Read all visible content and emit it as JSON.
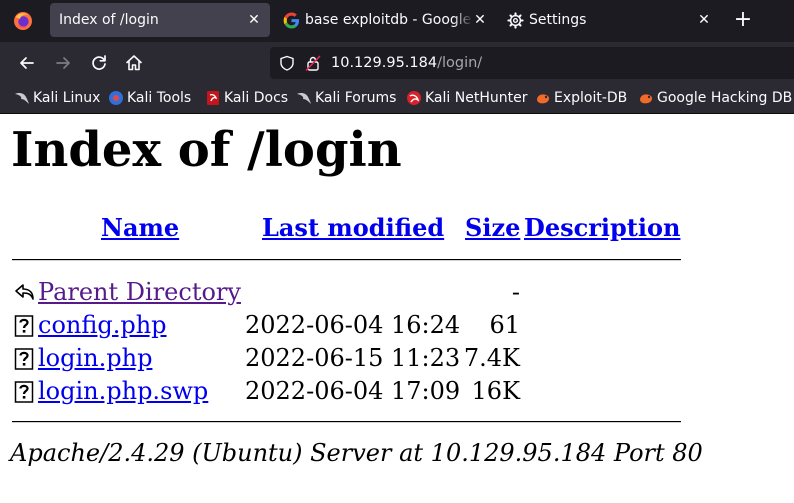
{
  "browser": {
    "tabs": [
      {
        "label": "Index of /login",
        "active": true,
        "icon": "none"
      },
      {
        "label": "base exploitdb - Google S",
        "active": false,
        "icon": "google-icon"
      },
      {
        "label": "Settings",
        "active": false,
        "icon": "gear-icon"
      }
    ],
    "new_tab_symbol": "+",
    "close_symbol": "✕",
    "url": {
      "host": "10.129.95.184",
      "path": "/login/"
    },
    "bookmarks": [
      {
        "label": "Kali Linux",
        "icon": "kali-dragon-icon"
      },
      {
        "label": "Kali Tools",
        "icon": "kali-tools-icon"
      },
      {
        "label": "Kali Docs",
        "icon": "kali-docs-icon"
      },
      {
        "label": "Kali Forums",
        "icon": "kali-dragon-icon"
      },
      {
        "label": "Kali NetHunter",
        "icon": "nethunter-icon"
      },
      {
        "label": "Exploit-DB",
        "icon": "exploitdb-icon"
      },
      {
        "label": "Google Hacking DB",
        "icon": "exploitdb-icon"
      }
    ],
    "colors": {
      "tabstrip": "#1c1b22",
      "toolbar": "#2b2a33",
      "active_tab": "#42414d",
      "text": "#fbfbfe"
    }
  },
  "page": {
    "title": "Index of /login",
    "headers": {
      "name": "Name",
      "modified": "Last modified",
      "size": "Size",
      "description": "Description"
    },
    "rows": [
      {
        "name": "Parent Directory",
        "modified": "",
        "size": "-",
        "icon": "back-arrow-icon"
      },
      {
        "name": "config.php",
        "modified": "2022-06-04 16:24",
        "size": "61",
        "icon": "unknown-file-icon"
      },
      {
        "name": "login.php",
        "modified": "2022-06-15 11:23",
        "size": "7.4K",
        "icon": "unknown-file-icon"
      },
      {
        "name": "login.php.swp",
        "modified": "2022-06-04 17:09",
        "size": "16K",
        "icon": "unknown-file-icon"
      }
    ],
    "footer": "Apache/2.4.29 (Ubuntu) Server at 10.129.95.184 Port 80",
    "colors": {
      "link": "#0000ee",
      "visited": "#551a8b"
    }
  }
}
